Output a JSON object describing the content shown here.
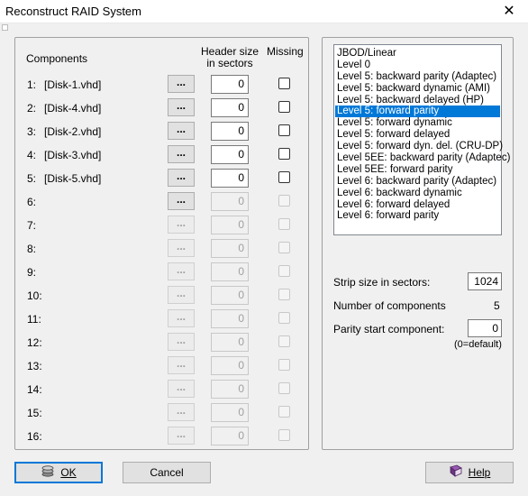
{
  "window": {
    "title": "Reconstruct RAID System",
    "close_glyph": "✕"
  },
  "components": {
    "heading": "Components",
    "header_size_label": "Header size in sectors",
    "missing_label": "Missing",
    "browse_label": "...",
    "rows": [
      {
        "num": "1:",
        "disk": "[Disk-1.vhd]",
        "header": "0",
        "enabled": true
      },
      {
        "num": "2:",
        "disk": "[Disk-4.vhd]",
        "header": "0",
        "enabled": true
      },
      {
        "num": "3:",
        "disk": "[Disk-2.vhd]",
        "header": "0",
        "enabled": true
      },
      {
        "num": "4:",
        "disk": "[Disk-3.vhd]",
        "header": "0",
        "enabled": true
      },
      {
        "num": "5:",
        "disk": "[Disk-5.vhd]",
        "header": "0",
        "enabled": true
      },
      {
        "num": "6:",
        "disk": "",
        "header": "0",
        "enabled": false,
        "browse_enabled": true
      },
      {
        "num": "7:",
        "disk": "",
        "header": "0",
        "enabled": false
      },
      {
        "num": "8:",
        "disk": "",
        "header": "0",
        "enabled": false
      },
      {
        "num": "9:",
        "disk": "",
        "header": "0",
        "enabled": false
      },
      {
        "num": "10:",
        "disk": "",
        "header": "0",
        "enabled": false
      },
      {
        "num": "11:",
        "disk": "",
        "header": "0",
        "enabled": false
      },
      {
        "num": "12:",
        "disk": "",
        "header": "0",
        "enabled": false
      },
      {
        "num": "13:",
        "disk": "",
        "header": "0",
        "enabled": false
      },
      {
        "num": "14:",
        "disk": "",
        "header": "0",
        "enabled": false
      },
      {
        "num": "15:",
        "disk": "",
        "header": "0",
        "enabled": false
      },
      {
        "num": "16:",
        "disk": "",
        "header": "0",
        "enabled": false
      }
    ]
  },
  "raid_types": {
    "selected_index": 5,
    "options": [
      "JBOD/Linear",
      "Level 0",
      "Level 5: backward parity (Adaptec)",
      "Level 5: backward dynamic (AMI)",
      "Level 5: backward delayed (HP)",
      "Level 5: forward parity",
      "Level 5: forward dynamic",
      "Level 5: forward delayed",
      "Level 5: forward dyn. del. (CRU-DP)",
      "Level 5EE: backward parity (Adaptec)",
      "Level 5EE: forward parity",
      "Level 6: backward parity (Adaptec)",
      "Level 6: backward dynamic",
      "Level 6: forward delayed",
      "Level 6: forward parity"
    ]
  },
  "settings": {
    "strip_size_label": "Strip size in sectors:",
    "strip_size_value": "1024",
    "num_components_label": "Number of components",
    "num_components_value": "5",
    "parity_start_label": "Parity start component:",
    "parity_start_value": "0",
    "parity_start_hint": "(0=default)"
  },
  "buttons": {
    "ok_label": "OK",
    "cancel_label": "Cancel",
    "help_label": "Help"
  },
  "colors": {
    "selection": "#0078d7",
    "default_button_border": "#0078d7"
  }
}
